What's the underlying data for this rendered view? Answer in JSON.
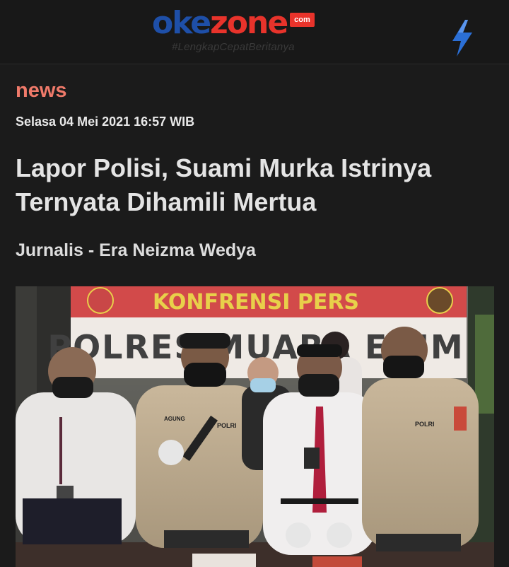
{
  "header": {
    "logo_oke": "oke",
    "logo_zone": "zone",
    "logo_com": "com",
    "tagline": "#LengkapCepatBeritanya",
    "colors": {
      "logo_blue": "#1e4fa8",
      "logo_red": "#e8332b",
      "bolt": "#2b6fd6"
    },
    "bolt_icon": "lightning-bolt-icon"
  },
  "article": {
    "category": "news",
    "date": "Selasa 04 Mei 2021 16:57 WIB",
    "title": "Lapor Polisi, Suami Murka Istrinya Ternyata Dihamili Mertua",
    "byline": "Jurnalis - Era Neizma Wedya",
    "category_color": "#f07a6a"
  },
  "photo": {
    "banner_top": "KONFRENSI PERS",
    "banner_main": "POLRES MUARA ENIM",
    "badge_1": "POLRI",
    "badge_2": "POLRI",
    "name_tag": "AGUNG"
  }
}
